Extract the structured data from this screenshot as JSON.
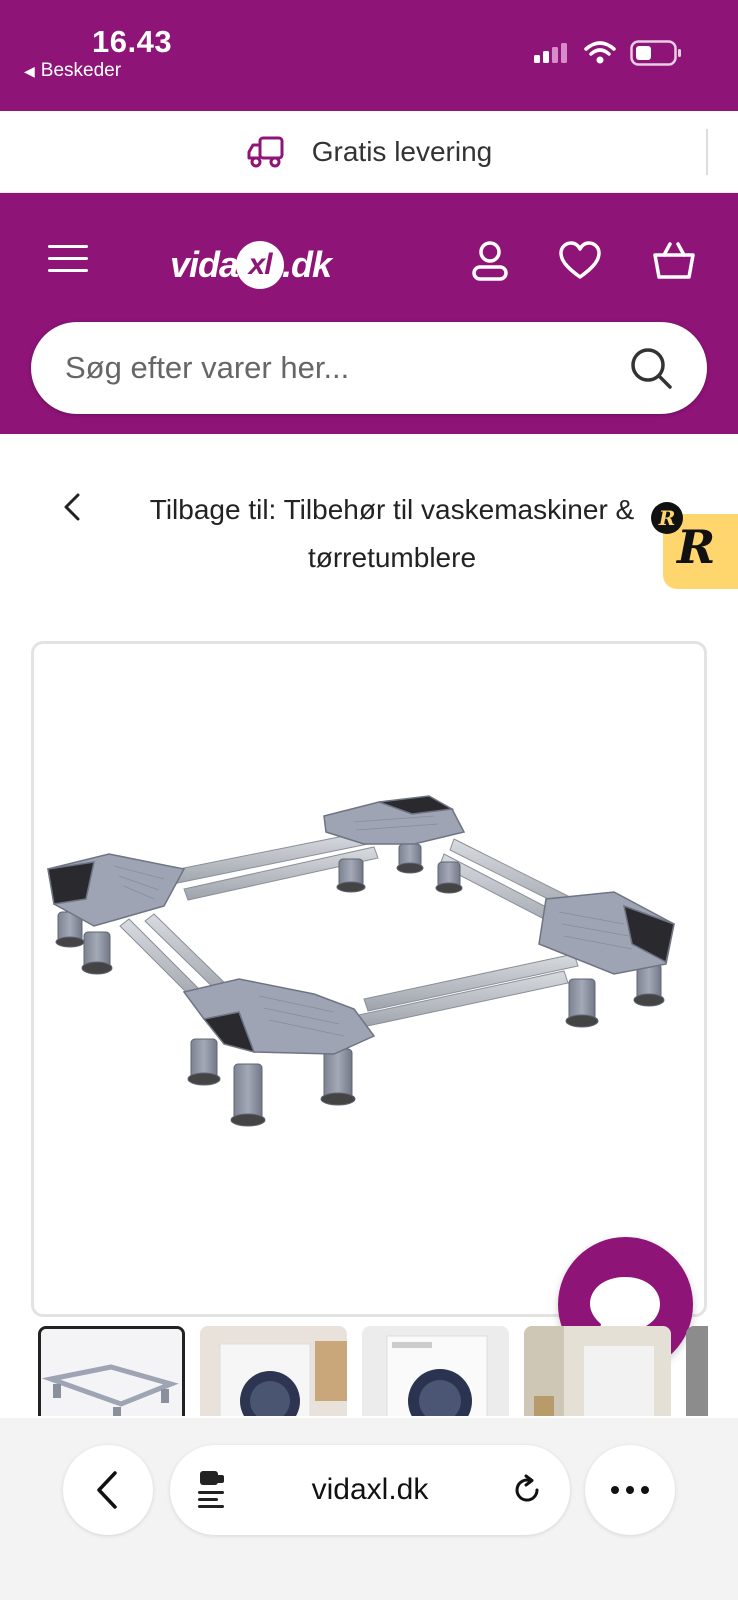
{
  "status_bar": {
    "time": "16.43",
    "back_app": "Beskeder",
    "icons": [
      "signal-icon",
      "wifi-icon",
      "battery-icon"
    ]
  },
  "promo": {
    "icon": "delivery-truck-icon",
    "text": "Gratis levering"
  },
  "header": {
    "logo": {
      "part1": "vida",
      "part2": "xl",
      "part3": ".dk"
    },
    "icons": [
      "menu-icon",
      "account-icon",
      "heart-icon",
      "basket-icon"
    ]
  },
  "search": {
    "placeholder": "Søg efter varer her..."
  },
  "breadcrumb": {
    "text": "Tilbage til: Tilbehør til vaskemaskiner & tørretumblere"
  },
  "badge": {
    "small": "R",
    "big": "R"
  },
  "product": {
    "image": "washing-machine-base-stand"
  },
  "thumbnails": [
    {
      "id": "thumb-1",
      "active": true
    },
    {
      "id": "thumb-2",
      "active": false
    },
    {
      "id": "thumb-3",
      "active": false
    },
    {
      "id": "thumb-4",
      "active": false
    }
  ],
  "browser": {
    "url": "vidaxl.dk",
    "icons": [
      "back-icon",
      "reader-icon",
      "reload-icon",
      "more-icon"
    ]
  },
  "colors": {
    "brand": "#8e1478",
    "badge": "#ffd56e"
  }
}
